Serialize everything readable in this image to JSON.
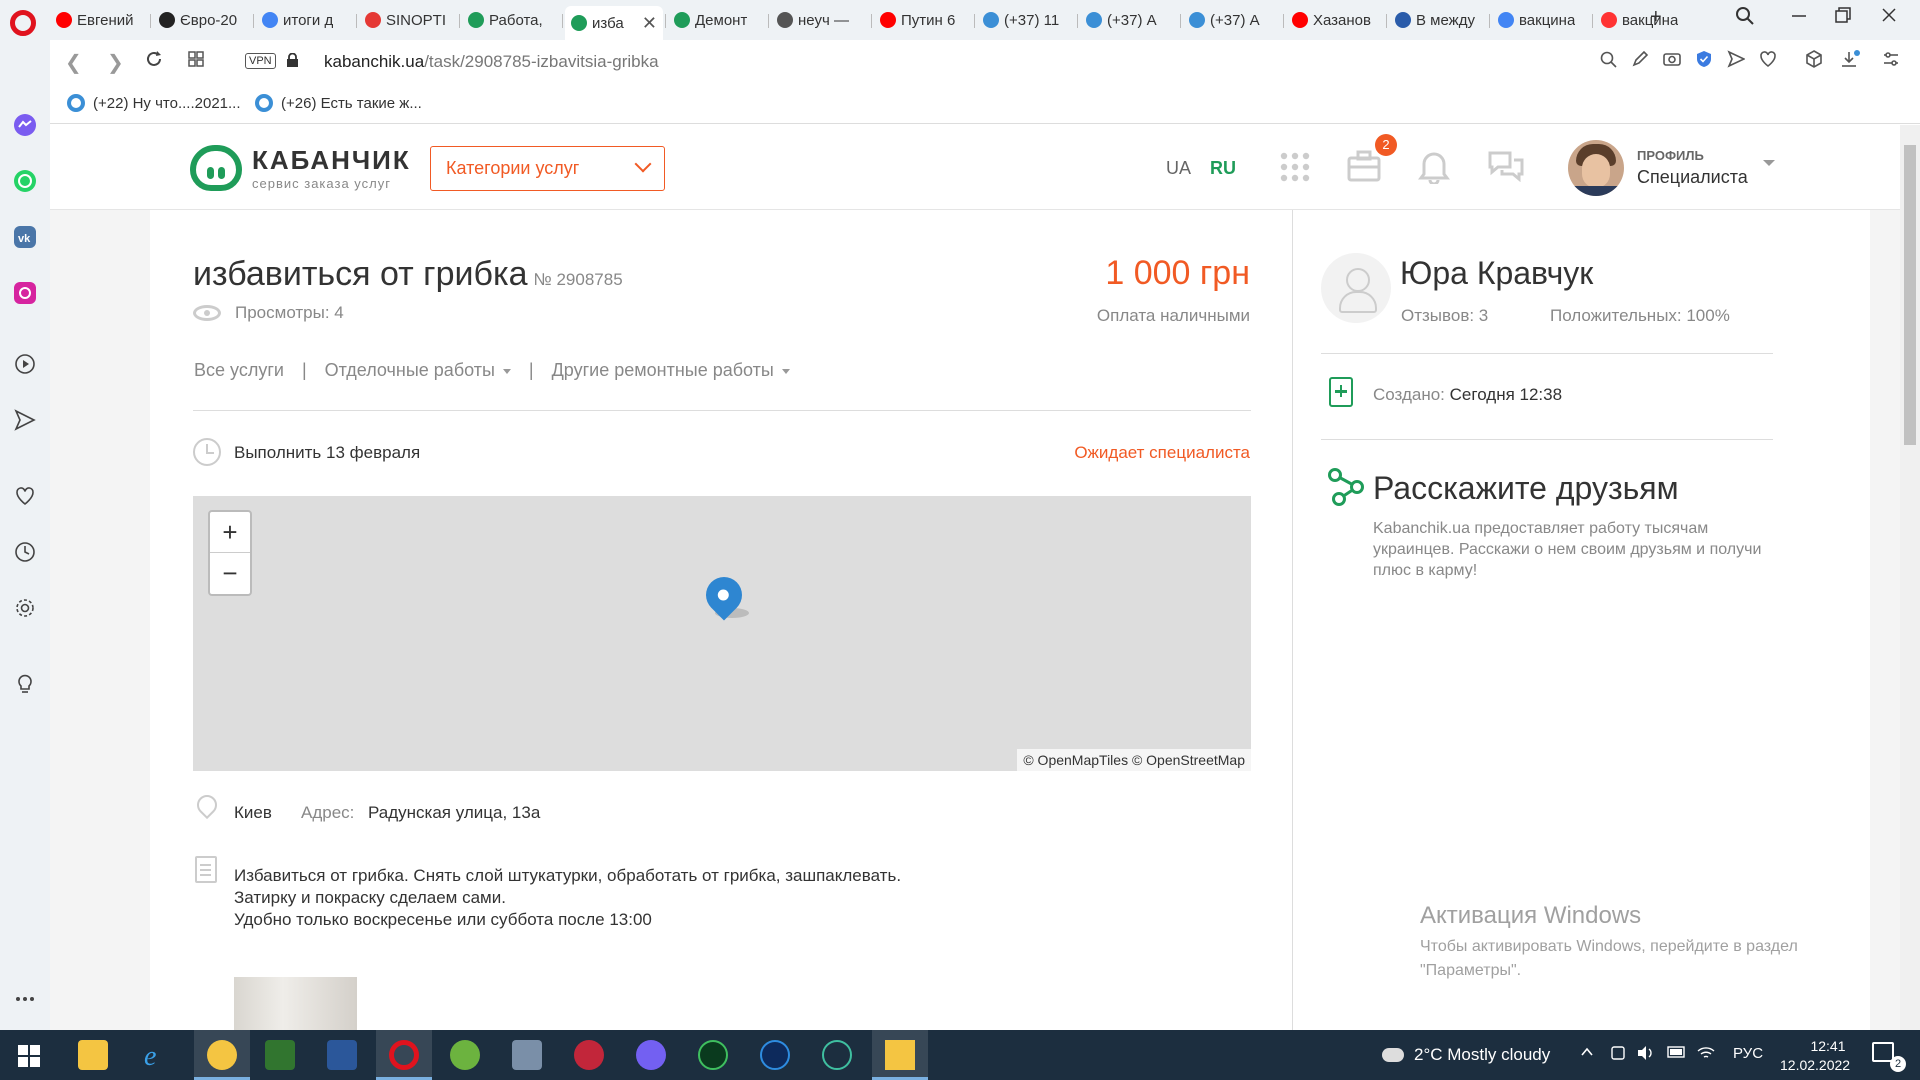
{
  "browser": {
    "tabs": [
      {
        "label": "Евгений",
        "color": "#ff0000"
      },
      {
        "label": "Євро-20",
        "color": "#222222"
      },
      {
        "label": "итоги д",
        "color": "#4285f4"
      },
      {
        "label": "SINOPTI",
        "color": "#e53935"
      },
      {
        "label": "Работа,",
        "color": "#1f9c59"
      },
      {
        "label": "изба",
        "color": "#1f9c59",
        "active": true
      },
      {
        "label": "Демонт",
        "color": "#1f9c59"
      },
      {
        "label": "неуч —",
        "color": "#555555"
      },
      {
        "label": "Путин 6",
        "color": "#ff0000"
      },
      {
        "label": "(+37) 11",
        "color": "#3b8fd6"
      },
      {
        "label": "(+37) А",
        "color": "#3b8fd6"
      },
      {
        "label": "(+37) А",
        "color": "#3b8fd6"
      },
      {
        "label": "Хазанов",
        "color": "#ff0000"
      },
      {
        "label": "В между",
        "color": "#2a5caa"
      },
      {
        "label": "вакцина",
        "color": "#4285f4"
      },
      {
        "label": "вакцина",
        "color": "#ff3333"
      }
    ],
    "tab_close": "✕",
    "new_tab": "+",
    "url_host": "kabanchik.ua",
    "url_path": "/task/2908785-izbavitsia-gribka",
    "vpn_label": "VPN",
    "bookmarks": [
      "(+22) Ну что....2021...",
      "(+26) Есть такие ж..."
    ]
  },
  "site": {
    "logo_name": "КАБАНЧИК",
    "logo_sub": "сервис заказа услуг",
    "categories_button": "Категории услуг",
    "lang_ua": "UA",
    "lang_ru": "RU",
    "notification_count": "2",
    "profile_label": "ПРОФИЛЬ",
    "profile_sub": "Специалиста"
  },
  "task": {
    "title": "избавиться от грибка",
    "number": "№ 2908785",
    "price": "1 000 грн",
    "views": "Просмотры: 4",
    "payment": "Оплата наличными",
    "breadcrumbs": [
      "Все услуги",
      "Отделочные работы",
      "Другие ремонтные работы"
    ],
    "breadcrumb_sep": "|",
    "deadline": "Выполнить 13 февраля",
    "status": "Ожидает специалиста",
    "map_attribution": "© OpenMapTiles © OpenStreetMap",
    "zoom_in": "+",
    "zoom_out": "−",
    "city": "Киев",
    "address_label": "Адрес:",
    "address": "Радунская улица, 13а",
    "description": [
      "Избавиться от грибка. Снять слой штукатурки, обработать от грибка, зашпаклевать.",
      "Затирку и покраску сделаем сами.",
      "Удобно только воскресенье или суббота после 13:00"
    ]
  },
  "customer": {
    "name": "Юра Кравчук",
    "reviews": "Отзывов: 3",
    "positive": "Положительных: 100%",
    "created_label": "Создано:",
    "created_value": "Сегодня 12:38",
    "share_title": "Расскажите друзьям",
    "share_text": "Kabanchik.ua предоставляет работу тысячам украинцев. Расскажи о нем своим друзьям и получи плюс в карму!"
  },
  "windows": {
    "watermark_title": "Активация Windows",
    "watermark_text": "Чтобы активировать Windows, перейдите в раздел \"Параметры\".",
    "weather": "2°C  Mostly cloudy",
    "lang": "РУС",
    "time": "12:41",
    "date": "12.02.2022",
    "notification_count": "2"
  },
  "colors": {
    "brand_green": "#1f9c59",
    "accent_orange": "#f15a24",
    "map_pin": "#2e86d1",
    "taskbar": "#1c2e3f"
  }
}
